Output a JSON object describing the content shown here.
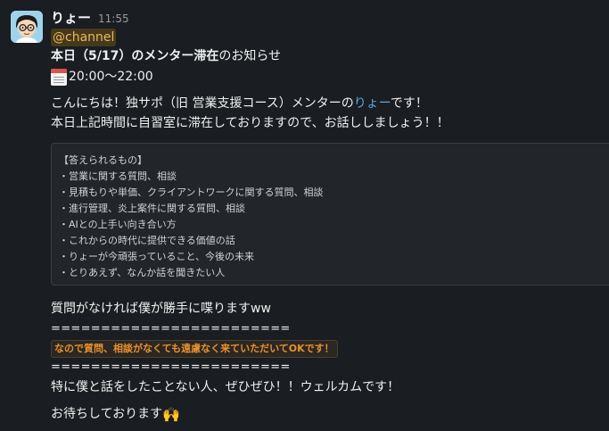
{
  "message": {
    "username": "りょー",
    "timestamp": "11:55",
    "mention": "@channel",
    "announce_date": "本日（5/17）",
    "announce_mentor": "のメンター滞在",
    "announce_suffix": "のお知らせ",
    "time_range": "20:00〜22:00",
    "intro_before": "こんにちは！独サポ（旧 営業支援コース）メンターの",
    "intro_name": "りょー",
    "intro_after": "です！",
    "intro_line2": "本日上記時間に自習室に滞在しておりますので、お話ししましょう！！",
    "code_block": [
      "【答えられるもの】",
      "・営業に関する質問、相談",
      "・見積もりや単価、クライアントワークに関する質問、相談",
      "・進行管理、炎上案件に関する質問、相談",
      "・AIとの上手い向き合い方",
      "・これからの時代に提供できる価値の話",
      "・りょーが今頑張っていること、今後の未来",
      "・とりあえず、なんか話を聞きたい人"
    ],
    "line_talk": "質問がなければ僕が勝手に喋りますww",
    "separator": "========================",
    "highlight": "なので質問、相談がなくても遠慮なく来ていただいてOKです！",
    "line_welcome": "特に僕と話をしたことない人、ぜひぜひ！！ウェルカムです！",
    "line_waiting": "お待ちしております",
    "icons": {
      "calendar": "calendar-icon",
      "hands": "raised-hands-icon"
    }
  }
}
